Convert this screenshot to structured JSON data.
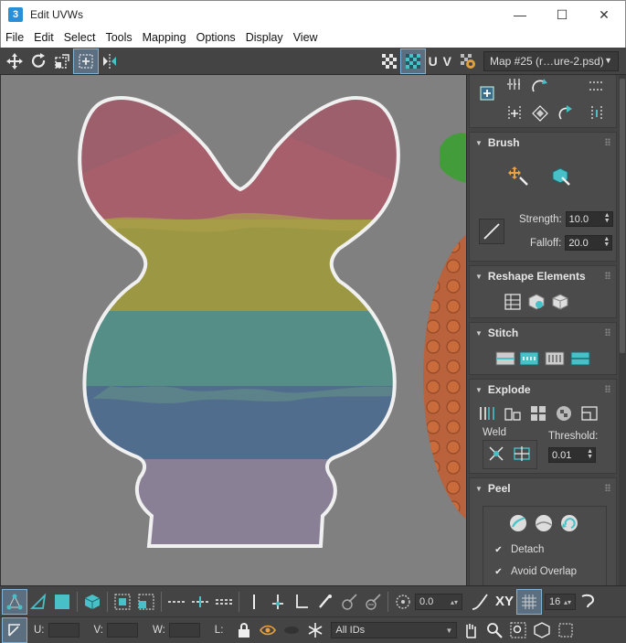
{
  "window": {
    "title": "Edit UVWs",
    "app_icon": "3",
    "minimize": "—",
    "maximize": "☐",
    "close": "✕"
  },
  "menu": [
    "File",
    "Edit",
    "Select",
    "Tools",
    "Mapping",
    "Options",
    "Display",
    "View"
  ],
  "toolbar": {
    "uv_label": "U V",
    "map_select": "Map #25 (r…ure-2.psd)"
  },
  "panel": {
    "brush": {
      "title": "Brush",
      "strength_label": "Strength:",
      "strength_value": "10.0",
      "falloff_label": "Falloff:",
      "falloff_value": "20.0"
    },
    "reshape": {
      "title": "Reshape Elements"
    },
    "stitch": {
      "title": "Stitch"
    },
    "explode": {
      "title": "Explode",
      "weld_label": "Weld",
      "threshold_label": "Threshold:",
      "threshold_value": "0.01"
    },
    "peel": {
      "title": "Peel",
      "detach_label": "Detach",
      "detach_checked": true,
      "avoid_overlap_label": "Avoid Overlap",
      "avoid_overlap_checked": true
    }
  },
  "bottom": {
    "rotate_value": "0.0",
    "xy_label": "XY",
    "grid_value": "16",
    "u_label": "U:",
    "v_label": "V:",
    "w_label": "W:",
    "l_label": "L:",
    "ids_select": "All IDs"
  },
  "colors": {
    "accent": "#48c0c8",
    "uv_outline": "#ffffff",
    "checker_active": "#5b6f80"
  },
  "uv_bands": [
    "#a05a68",
    "#a09a3a",
    "#4e9088",
    "#4a6a90",
    "#8a8098"
  ]
}
